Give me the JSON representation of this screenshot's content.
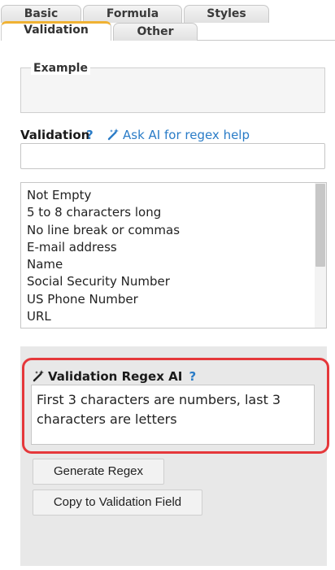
{
  "tabs": [
    {
      "label": "Basic",
      "active": false
    },
    {
      "label": "Formula",
      "active": false
    },
    {
      "label": "Styles",
      "active": false
    },
    {
      "label": "Validation",
      "active": true
    },
    {
      "label": "Other",
      "active": false
    }
  ],
  "example": {
    "legend": "Example"
  },
  "validation": {
    "label": "Validation",
    "help": "?",
    "ai_link": "Ask AI for regex help",
    "value": ""
  },
  "presets": [
    "Not Empty",
    "5 to 8 characters long",
    "No line break or commas",
    "E-mail address",
    "Name",
    "Social Security Number",
    "US Phone Number",
    "URL"
  ],
  "ai_panel": {
    "title": "Validation Regex AI",
    "help": "?",
    "prompt_text": "First 3 characters are numbers, last 3 characters are letters",
    "generate_label": "Generate Regex",
    "copy_label": "Copy to Validation Field"
  },
  "colors": {
    "accent_tab": "#f0b233",
    "link": "#2a7cc7",
    "highlight": "#e5383b"
  }
}
